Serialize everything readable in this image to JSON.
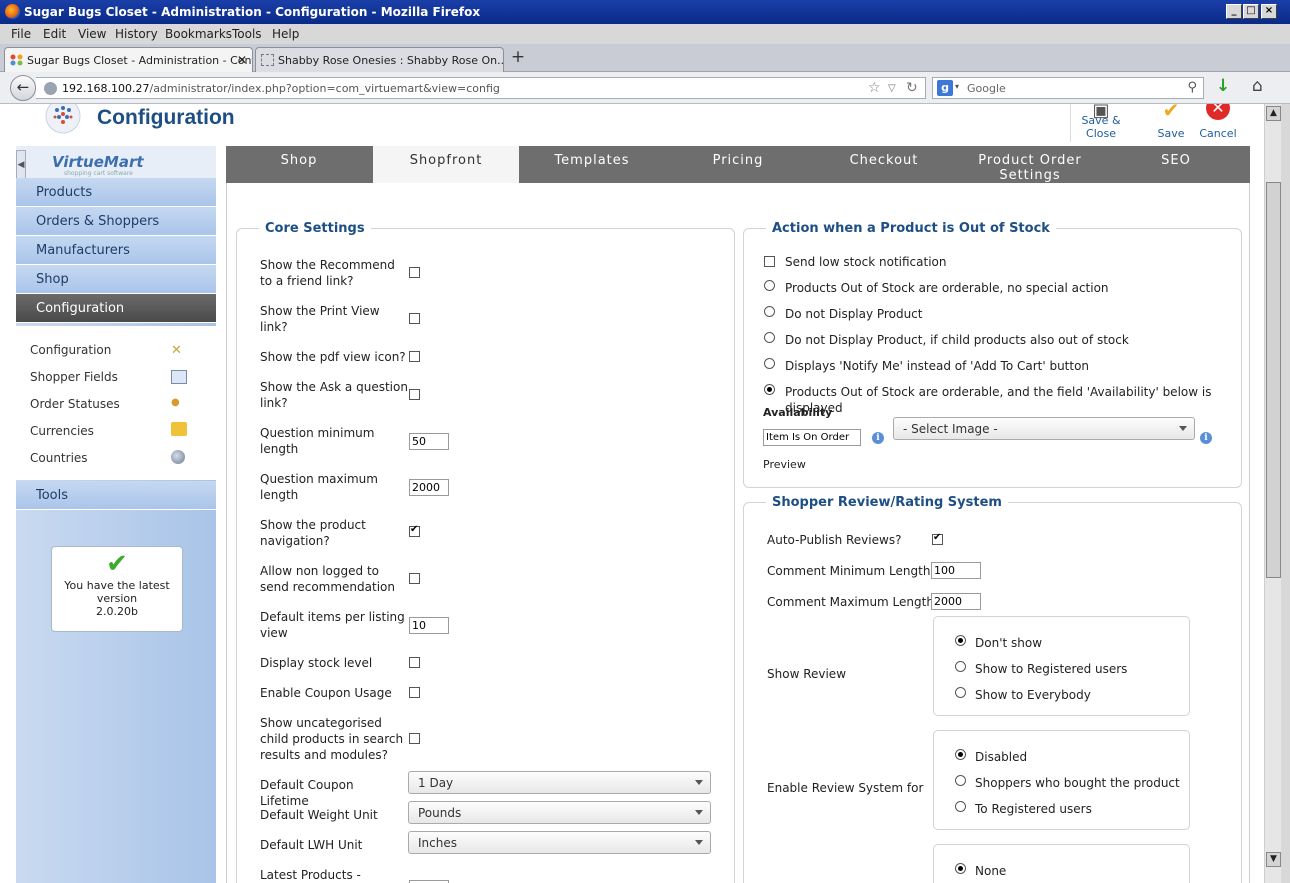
{
  "window": {
    "title": "Sugar Bugs Closet - Administration - Configuration - Mozilla Firefox",
    "controls": {
      "minimize": "_",
      "maximize": "□",
      "close": "×"
    }
  },
  "menu": [
    "File",
    "Edit",
    "View",
    "History",
    "Bookmarks",
    "Tools",
    "Help"
  ],
  "tabs": [
    {
      "label": "Sugar Bugs Closet - Administration - Conf...",
      "active": true
    },
    {
      "label": "Shabby Rose Onesies : Shabby Rose On...",
      "active": false
    }
  ],
  "nav": {
    "url_host": "192.168.100.27",
    "url_path": "/administrator/index.php?option=com_virtuemart&view=config",
    "search_placeholder": "Google"
  },
  "header": {
    "title": "Configuration",
    "buttons": {
      "save_close": "Save & Close",
      "save": "Save",
      "cancel": "Cancel"
    }
  },
  "sidebar": {
    "logo_text": "VirtueMart",
    "logo_tag": "shopping cart software",
    "items": [
      "Products",
      "Orders & Shoppers",
      "Manufacturers",
      "Shop",
      "Configuration"
    ],
    "sub_items": [
      "Configuration",
      "Shopper Fields",
      "Order Statuses",
      "Currencies",
      "Countries"
    ],
    "tools": "Tools",
    "version": {
      "line1": "You have the latest",
      "line2": "version",
      "number": "2.0.20b"
    }
  },
  "config_tabs": [
    "Shop",
    "Shopfront",
    "Templates",
    "Pricing",
    "Checkout",
    "Product Order Settings",
    "SEO"
  ],
  "core_settings": {
    "legend": "Core Settings",
    "recommend": {
      "label": "Show the Recommend to a friend link?",
      "checked": false
    },
    "print_view": {
      "label": "Show the Print View link?",
      "checked": false
    },
    "pdf_icon": {
      "label": "Show the pdf view icon?",
      "checked": false
    },
    "ask_question": {
      "label": "Show the Ask a question link?",
      "checked": false
    },
    "question_min": {
      "label": "Question minimum length",
      "value": "50"
    },
    "question_max": {
      "label": "Question maximum length",
      "value": "2000"
    },
    "product_nav": {
      "label": "Show the product navigation?",
      "checked": true
    },
    "non_logged": {
      "label": "Allow non logged to send recommendation",
      "checked": false
    },
    "items_per_listing": {
      "label": "Default items per listing view",
      "value": "10"
    },
    "stock_level": {
      "label": "Display stock level",
      "checked": false
    },
    "coupon_usage": {
      "label": "Enable Coupon Usage",
      "checked": false
    },
    "uncategorised": {
      "label": "Show uncategorised child products in search results and modules?",
      "checked": false
    },
    "coupon_lifetime": {
      "label": "Default Coupon Lifetime",
      "value": "1 Day"
    },
    "weight_unit": {
      "label": "Default Weight Unit",
      "value": "Pounds"
    },
    "lwh_unit": {
      "label": "Default LWH Unit",
      "value": "Inches"
    },
    "latest_products": {
      "label": "Latest Products -"
    }
  },
  "out_of_stock": {
    "legend": "Action when a Product is Out of Stock",
    "low_stock": {
      "label": "Send low stock notification",
      "checked": false
    },
    "options": [
      {
        "label": "Products Out of Stock are orderable, no special action",
        "selected": false
      },
      {
        "label": "Do not Display Product",
        "selected": false
      },
      {
        "label": "Do not Display Product, if child products also out of stock",
        "selected": false
      },
      {
        "label": "Displays 'Notify Me' instead of 'Add To Cart' button",
        "selected": false
      },
      {
        "label": "Products Out of Stock are orderable, and the field 'Availability' below is displayed",
        "selected": true
      }
    ],
    "availability_label": "Availability",
    "availability_value": "Item Is On Order",
    "image_select": "- Select Image -",
    "preview": "Preview"
  },
  "reviews": {
    "legend": "Shopper Review/Rating System",
    "auto_publish": {
      "label": "Auto-Publish Reviews?",
      "checked": true
    },
    "comment_min": {
      "label": "Comment Minimum Length",
      "value": "100"
    },
    "comment_max": {
      "label": "Comment Maximum Length",
      "value": "2000"
    },
    "show_review": {
      "label": "Show Review",
      "options": [
        {
          "label": "Don't show",
          "selected": true
        },
        {
          "label": "Show to Registered users",
          "selected": false
        },
        {
          "label": "Show to Everybody",
          "selected": false
        }
      ]
    },
    "enable_for": {
      "label": "Enable Review System for",
      "options": [
        {
          "label": "Disabled",
          "selected": true
        },
        {
          "label": "Shoppers who bought the product",
          "selected": false
        },
        {
          "label": "To Registered users",
          "selected": false
        }
      ]
    },
    "rating_first": {
      "label": "None",
      "selected": true
    }
  },
  "colors": {
    "accent": "#1d4f84",
    "tabbar": "#6e6e6e",
    "sidebar_active": "#4a4a4a"
  }
}
